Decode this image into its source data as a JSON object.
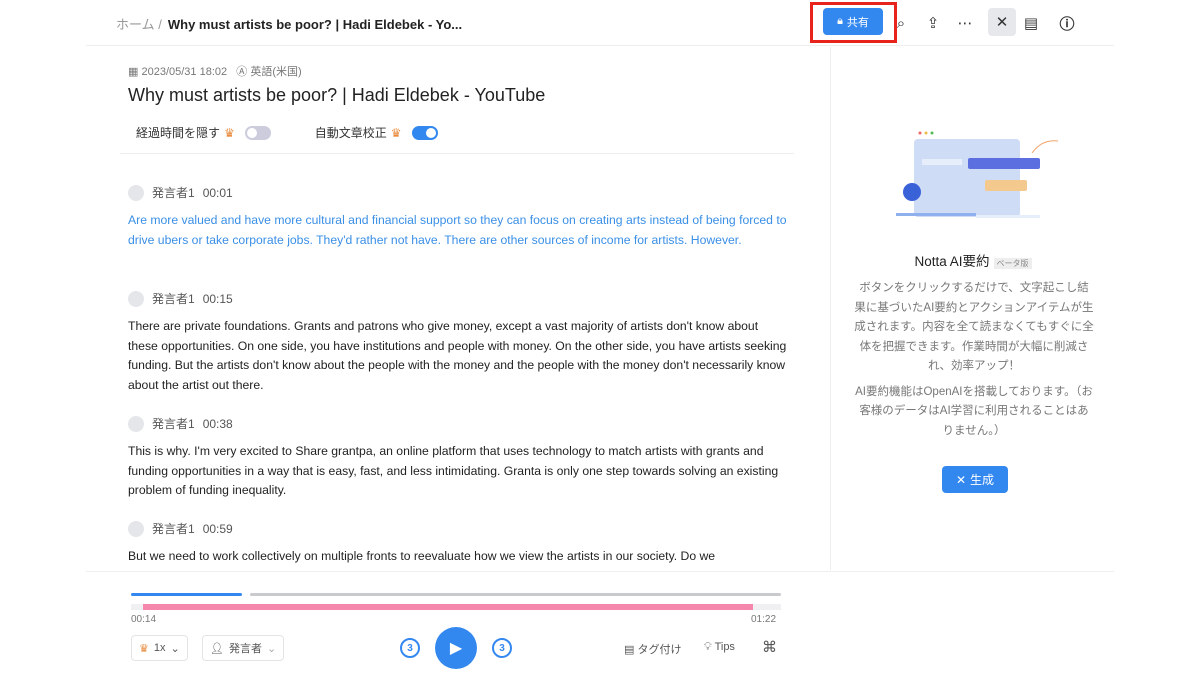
{
  "header": {
    "breadcrumb_home": "ホーム",
    "breadcrumb_sep": "/",
    "breadcrumb_current": "Why must artists be poor? | Hadi Eldebek - Yo...",
    "share_label": "共有",
    "icons": [
      "search-icon",
      "upload-icon",
      "more-icon",
      "ai-summary-icon",
      "notes-icon",
      "help-icon"
    ]
  },
  "doc": {
    "date": "2023/05/31 18:02",
    "language": "英語(米国)",
    "title": "Why must artists be poor? | Hadi Eldebek - YouTube",
    "hide_time_label": "経過時間を隠す",
    "hide_time_on": false,
    "auto_correct_label": "自動文章校正",
    "auto_correct_on": true
  },
  "segments": [
    {
      "speaker": "発言者1",
      "time": "00:01",
      "text": "Are more valued and have more cultural and financial support so they can focus on creating arts instead of being forced to drive ubers or take corporate jobs. They'd rather not have. There are other sources of income for artists. However.",
      "active": true
    },
    {
      "speaker": "発言者1",
      "time": "00:15",
      "text": "There are private foundations. Grants and patrons who give money, except a vast majority of artists don't know about these opportunities. On one side, you have institutions and people with money. On the other side, you have artists seeking funding. But the artists don't know about the people with the money and the people with the money don't necessarily know about the artist out there."
    },
    {
      "speaker": "発言者1",
      "time": "00:38",
      "text": "This is why. I'm very excited to Share grantpa, an online platform that uses technology to match artists with grants and funding opportunities in a way that is easy, fast, and less intimidating. Granta is only one step towards solving an existing problem of funding inequality."
    },
    {
      "speaker": "発言者1",
      "time": "00:59",
      "text": "But we need to work collectively on multiple fronts to reevaluate how we view the artists in our society. Do we"
    }
  ],
  "sidebar": {
    "title": "Notta AI要約",
    "badge": "ベータ版",
    "desc1": "ボタンをクリックするだけで、文字起こし結果に基づいたAI要約とアクションアイテムが生成されます。内容を全て読まなくてもすぐに全体を把握できます。作業時間が大幅に削減され、効率アップ！",
    "desc2": "AI要約機能はOpenAIを搭載しております。（お客様のデータはAI学習に利用されることはありません。）",
    "generate_label": "生成"
  },
  "player": {
    "current": "00:14",
    "total": "01:22",
    "progress_percent": 17,
    "speed": "1x",
    "speaker_filter": "発言者",
    "skip_back": "3",
    "skip_fwd": "3",
    "tag_label": "タグ付け",
    "tips_label": "Tips",
    "accent": "#3388f0",
    "waveform_color": "#f487ab"
  }
}
